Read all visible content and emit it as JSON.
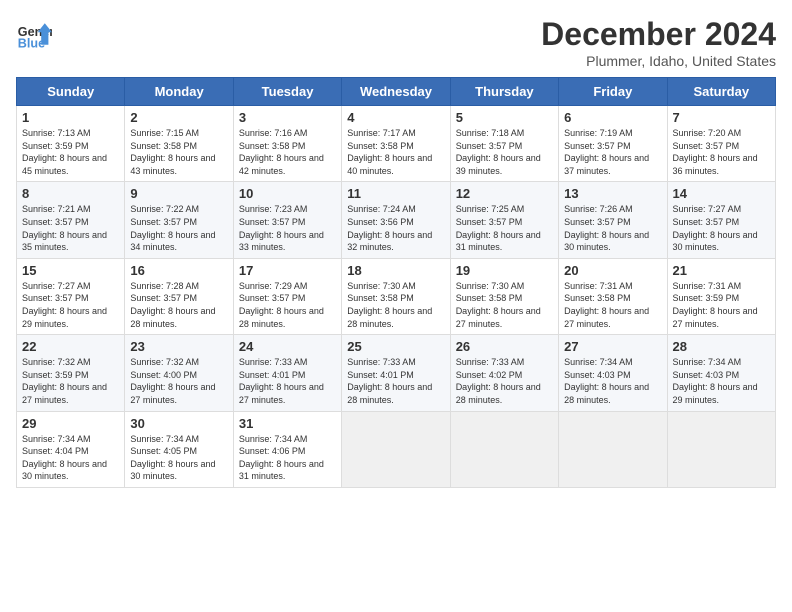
{
  "header": {
    "logo_general": "General",
    "logo_blue": "Blue",
    "month_title": "December 2024",
    "location": "Plummer, Idaho, United States"
  },
  "calendar": {
    "days_of_week": [
      "Sunday",
      "Monday",
      "Tuesday",
      "Wednesday",
      "Thursday",
      "Friday",
      "Saturday"
    ],
    "weeks": [
      [
        {
          "day": "1",
          "sunrise": "7:13 AM",
          "sunset": "3:59 PM",
          "daylight": "8 hours and 45 minutes."
        },
        {
          "day": "2",
          "sunrise": "7:15 AM",
          "sunset": "3:58 PM",
          "daylight": "8 hours and 43 minutes."
        },
        {
          "day": "3",
          "sunrise": "7:16 AM",
          "sunset": "3:58 PM",
          "daylight": "8 hours and 42 minutes."
        },
        {
          "day": "4",
          "sunrise": "7:17 AM",
          "sunset": "3:58 PM",
          "daylight": "8 hours and 40 minutes."
        },
        {
          "day": "5",
          "sunrise": "7:18 AM",
          "sunset": "3:57 PM",
          "daylight": "8 hours and 39 minutes."
        },
        {
          "day": "6",
          "sunrise": "7:19 AM",
          "sunset": "3:57 PM",
          "daylight": "8 hours and 37 minutes."
        },
        {
          "day": "7",
          "sunrise": "7:20 AM",
          "sunset": "3:57 PM",
          "daylight": "8 hours and 36 minutes."
        }
      ],
      [
        {
          "day": "8",
          "sunrise": "7:21 AM",
          "sunset": "3:57 PM",
          "daylight": "8 hours and 35 minutes."
        },
        {
          "day": "9",
          "sunrise": "7:22 AM",
          "sunset": "3:57 PM",
          "daylight": "8 hours and 34 minutes."
        },
        {
          "day": "10",
          "sunrise": "7:23 AM",
          "sunset": "3:57 PM",
          "daylight": "8 hours and 33 minutes."
        },
        {
          "day": "11",
          "sunrise": "7:24 AM",
          "sunset": "3:56 PM",
          "daylight": "8 hours and 32 minutes."
        },
        {
          "day": "12",
          "sunrise": "7:25 AM",
          "sunset": "3:57 PM",
          "daylight": "8 hours and 31 minutes."
        },
        {
          "day": "13",
          "sunrise": "7:26 AM",
          "sunset": "3:57 PM",
          "daylight": "8 hours and 30 minutes."
        },
        {
          "day": "14",
          "sunrise": "7:27 AM",
          "sunset": "3:57 PM",
          "daylight": "8 hours and 30 minutes."
        }
      ],
      [
        {
          "day": "15",
          "sunrise": "7:27 AM",
          "sunset": "3:57 PM",
          "daylight": "8 hours and 29 minutes."
        },
        {
          "day": "16",
          "sunrise": "7:28 AM",
          "sunset": "3:57 PM",
          "daylight": "8 hours and 28 minutes."
        },
        {
          "day": "17",
          "sunrise": "7:29 AM",
          "sunset": "3:57 PM",
          "daylight": "8 hours and 28 minutes."
        },
        {
          "day": "18",
          "sunrise": "7:30 AM",
          "sunset": "3:58 PM",
          "daylight": "8 hours and 28 minutes."
        },
        {
          "day": "19",
          "sunrise": "7:30 AM",
          "sunset": "3:58 PM",
          "daylight": "8 hours and 27 minutes."
        },
        {
          "day": "20",
          "sunrise": "7:31 AM",
          "sunset": "3:58 PM",
          "daylight": "8 hours and 27 minutes."
        },
        {
          "day": "21",
          "sunrise": "7:31 AM",
          "sunset": "3:59 PM",
          "daylight": "8 hours and 27 minutes."
        }
      ],
      [
        {
          "day": "22",
          "sunrise": "7:32 AM",
          "sunset": "3:59 PM",
          "daylight": "8 hours and 27 minutes."
        },
        {
          "day": "23",
          "sunrise": "7:32 AM",
          "sunset": "4:00 PM",
          "daylight": "8 hours and 27 minutes."
        },
        {
          "day": "24",
          "sunrise": "7:33 AM",
          "sunset": "4:01 PM",
          "daylight": "8 hours and 27 minutes."
        },
        {
          "day": "25",
          "sunrise": "7:33 AM",
          "sunset": "4:01 PM",
          "daylight": "8 hours and 28 minutes."
        },
        {
          "day": "26",
          "sunrise": "7:33 AM",
          "sunset": "4:02 PM",
          "daylight": "8 hours and 28 minutes."
        },
        {
          "day": "27",
          "sunrise": "7:34 AM",
          "sunset": "4:03 PM",
          "daylight": "8 hours and 28 minutes."
        },
        {
          "day": "28",
          "sunrise": "7:34 AM",
          "sunset": "4:03 PM",
          "daylight": "8 hours and 29 minutes."
        }
      ],
      [
        {
          "day": "29",
          "sunrise": "7:34 AM",
          "sunset": "4:04 PM",
          "daylight": "8 hours and 30 minutes."
        },
        {
          "day": "30",
          "sunrise": "7:34 AM",
          "sunset": "4:05 PM",
          "daylight": "8 hours and 30 minutes."
        },
        {
          "day": "31",
          "sunrise": "7:34 AM",
          "sunset": "4:06 PM",
          "daylight": "8 hours and 31 minutes."
        },
        null,
        null,
        null,
        null
      ]
    ]
  }
}
